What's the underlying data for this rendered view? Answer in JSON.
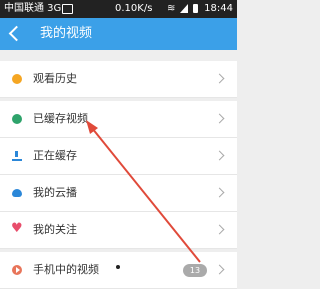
{
  "status_bar": {
    "carrier": "中国联通 3G",
    "speed": "0.10K/s",
    "time": "18:44"
  },
  "header": {
    "title": "我的视频"
  },
  "menu": [
    {
      "label": "观看历史",
      "icon": "history-icon"
    },
    {
      "label": "已缓存视频",
      "icon": "check-icon"
    },
    {
      "label": "正在缓存",
      "icon": "download-icon"
    },
    {
      "label": "我的云播",
      "icon": "cloud-icon"
    },
    {
      "label": "我的关注",
      "icon": "heart-icon"
    },
    {
      "label": "手机中的视频",
      "icon": "play-icon",
      "badge": "13"
    }
  ],
  "colors": {
    "header": "#3ba0e8",
    "annotation_arrow": "#e04a3a"
  }
}
